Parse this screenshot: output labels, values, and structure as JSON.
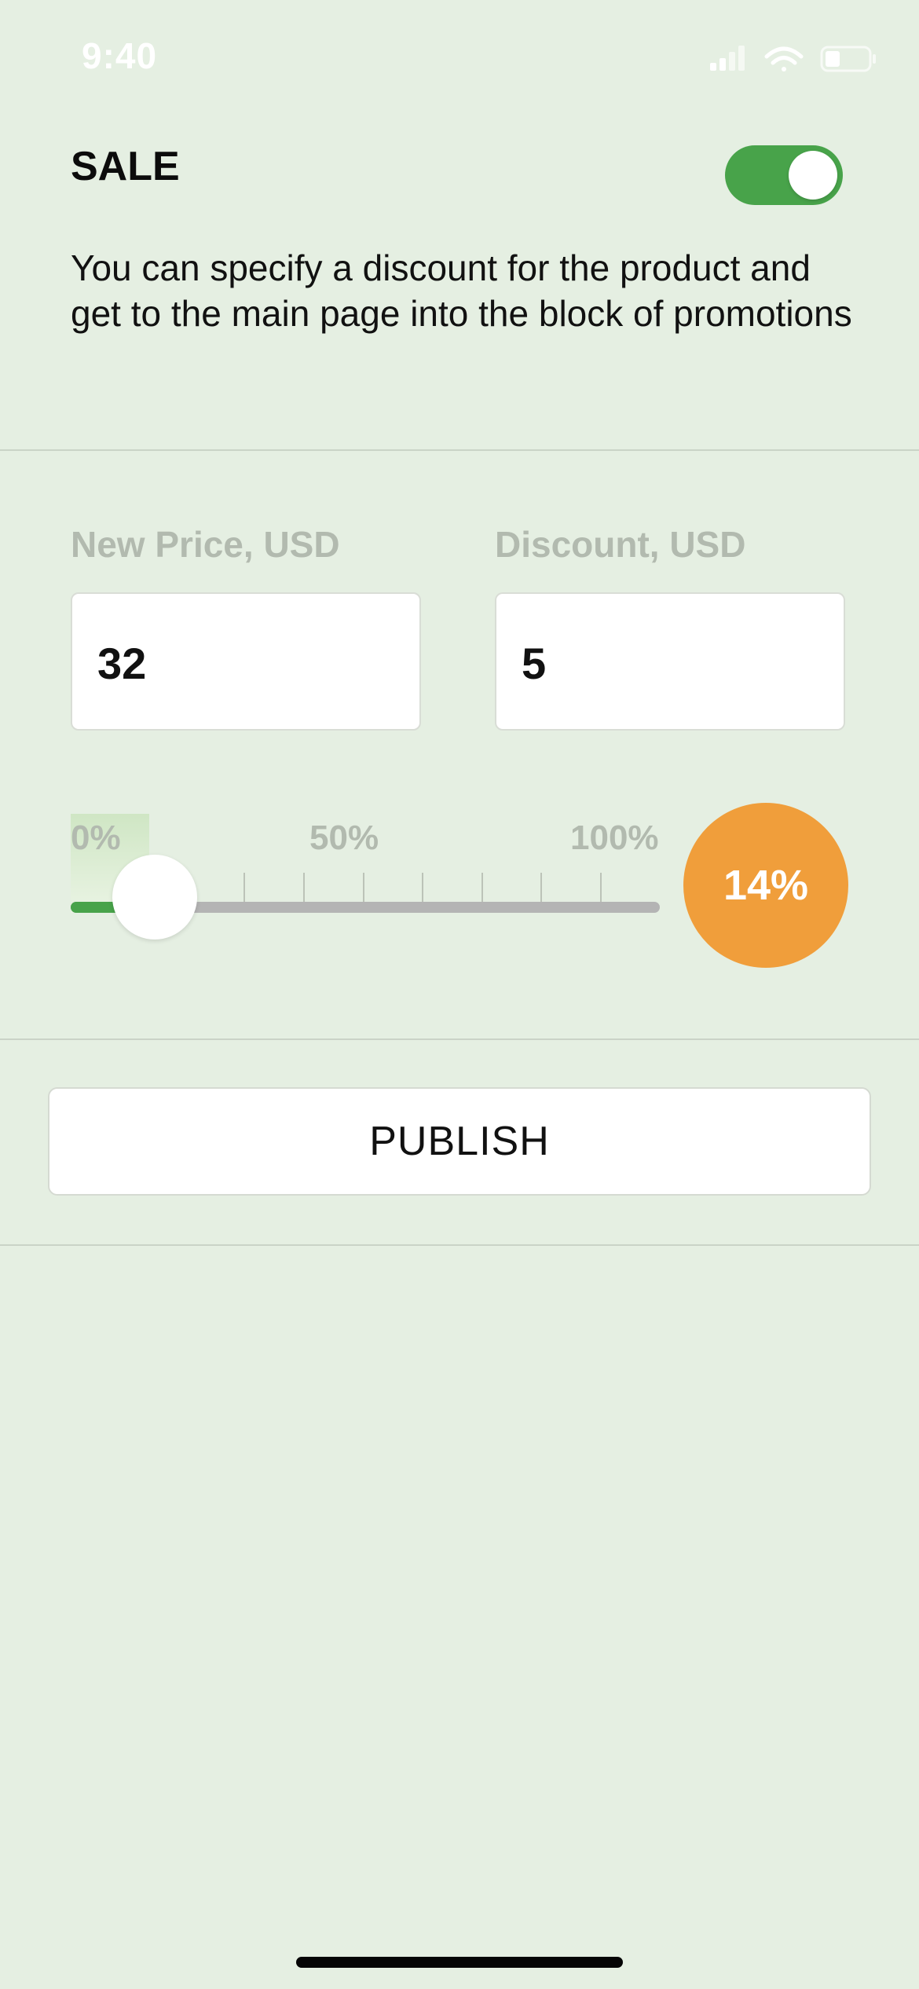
{
  "status_bar": {
    "time": "9:40",
    "icons": [
      "signal-icon",
      "wifi-icon",
      "battery-icon"
    ]
  },
  "sale": {
    "title": "SALE",
    "toggle_on": true,
    "description": "You can specify a discount for the product and get to the main page into the block of promotions"
  },
  "fields": {
    "new_price": {
      "label": "New Price, USD",
      "value": "32"
    },
    "discount": {
      "label": "Discount, USD",
      "value": "5"
    }
  },
  "slider": {
    "labels": [
      "0%",
      "50%",
      "100%"
    ],
    "value_percent": 14,
    "badge": "14%"
  },
  "publish": {
    "label": "PUBLISH"
  },
  "colors": {
    "background": "#E5EFE2",
    "accent_green": "#48A34A",
    "badge_orange": "#F09E3B",
    "label_gray": "#B2BAAF"
  }
}
